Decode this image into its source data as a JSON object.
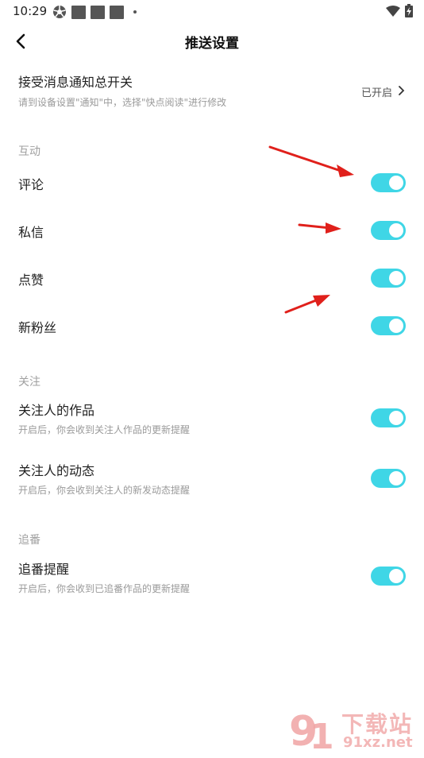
{
  "status_bar": {
    "time": "10:29"
  },
  "nav": {
    "title": "推送设置",
    "back_icon": "chevron-left-icon"
  },
  "master": {
    "title": "接受消息通知总开关",
    "subtitle": "请到设备设置\"通知\"中，选择\"快点阅读\"进行修改",
    "status": "已开启"
  },
  "sections": {
    "interaction": {
      "header": "互动",
      "items": [
        {
          "label": "评论",
          "on": true
        },
        {
          "label": "私信",
          "on": true
        },
        {
          "label": "点赞",
          "on": true
        },
        {
          "label": "新粉丝",
          "on": true
        }
      ]
    },
    "follow": {
      "header": "关注",
      "items": [
        {
          "label": "关注人的作品",
          "desc": "开启后，你会收到关注人作品的更新提醒",
          "on": true
        },
        {
          "label": "关注人的动态",
          "desc": "开启后，你会收到关注人的新发动态提醒",
          "on": true
        }
      ]
    },
    "chase": {
      "header": "追番",
      "items": [
        {
          "label": "追番提醒",
          "desc": "开启后，你会收到已追番作品的更新提醒",
          "on": true
        }
      ]
    }
  },
  "colors": {
    "toggle_on": "#3fd6e6",
    "arrow": "#e0201b"
  },
  "watermark": {
    "brand": "下载站",
    "url": "91xz.net"
  }
}
